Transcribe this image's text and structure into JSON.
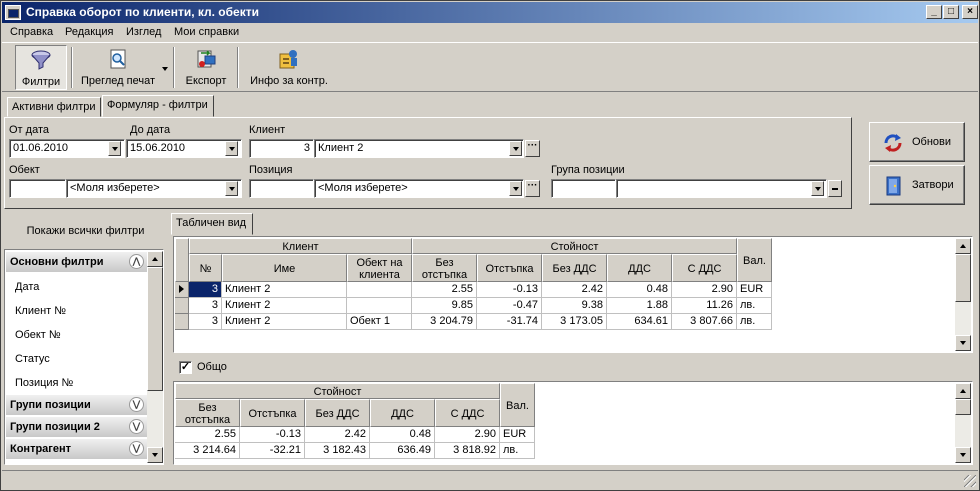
{
  "window": {
    "title": "Справка оборот по клиенти, кл. обекти"
  },
  "menu": [
    "Справка",
    "Редакция",
    "Изглед",
    "Мои справки"
  ],
  "toolbar": {
    "filters": "Филтри",
    "print_preview": "Преглед печат",
    "export": "Експорт",
    "info": "Инфо за контр."
  },
  "tabs": {
    "active_filters": "Активни филтри",
    "form_filters": "Формуляр - филтри"
  },
  "form": {
    "from_date_label": "От дата",
    "from_date": "01.06.2010",
    "to_date_label": "До дата",
    "to_date": "15.06.2010",
    "client_label": "Клиент",
    "client_code": "3",
    "client_name": "Клиент 2",
    "object_label": "Обект",
    "object_code": "",
    "object_value": "<Моля изберете>",
    "position_label": "Позиция",
    "position_code": "",
    "position_value": "<Моля изберете>",
    "group_label": "Група позиции",
    "group_code": "",
    "group_value": ""
  },
  "buttons": {
    "refresh": "Обнови",
    "close": "Затвори"
  },
  "left": {
    "show_all": "Покажи всички филтри",
    "groups": {
      "basic": "Основни филтри",
      "groups": "Групи позиции",
      "groups2": "Групи позиции 2",
      "counterparty": "Контрагент"
    },
    "items": [
      "Дата",
      "Клиент №",
      "Обект №",
      "Статус",
      "Позиция №"
    ]
  },
  "table_tab": "Табличен вид",
  "grid": {
    "h_client": "Клиент",
    "h_value": "Стойност",
    "h_no": "№",
    "h_name": "Име",
    "h_object": "Обект на клиента",
    "h_no_discount": "Без отстъпка",
    "h_discount": "Отстъпка",
    "h_no_vat": "Без ДДС",
    "h_vat": "ДДС",
    "h_with_vat": "С ДДС",
    "h_cur": "Вал.",
    "rows": [
      {
        "no": "3",
        "name": "Клиент 2",
        "object": "",
        "no_discount": "2.55",
        "discount": "-0.13",
        "no_vat": "2.42",
        "vat": "0.48",
        "with_vat": "2.90",
        "cur": "EUR"
      },
      {
        "no": "3",
        "name": "Клиент 2",
        "object": "",
        "no_discount": "9.85",
        "discount": "-0.47",
        "no_vat": "9.38",
        "vat": "1.88",
        "with_vat": "11.26",
        "cur": "лв."
      },
      {
        "no": "3",
        "name": "Клиент 2",
        "object": "Обект 1",
        "no_discount": "3 204.79",
        "discount": "-31.74",
        "no_vat": "3 173.05",
        "vat": "634.61",
        "with_vat": "3 807.66",
        "cur": "лв."
      }
    ]
  },
  "total": {
    "label": "Общо",
    "checked": true,
    "h_value": "Стойност",
    "h_no_discount": "Без отстъпка",
    "h_discount": "Отстъпка",
    "h_no_vat": "Без ДДС",
    "h_vat": "ДДС",
    "h_with_vat": "С ДДС",
    "h_cur": "Вал.",
    "rows": [
      {
        "no_discount": "2.55",
        "discount": "-0.13",
        "no_vat": "2.42",
        "vat": "0.48",
        "with_vat": "2.90",
        "cur": "EUR"
      },
      {
        "no_discount": "3 214.64",
        "discount": "-32.21",
        "no_vat": "3 182.43",
        "vat": "636.49",
        "with_vat": "3 818.92",
        "cur": "лв."
      }
    ]
  }
}
